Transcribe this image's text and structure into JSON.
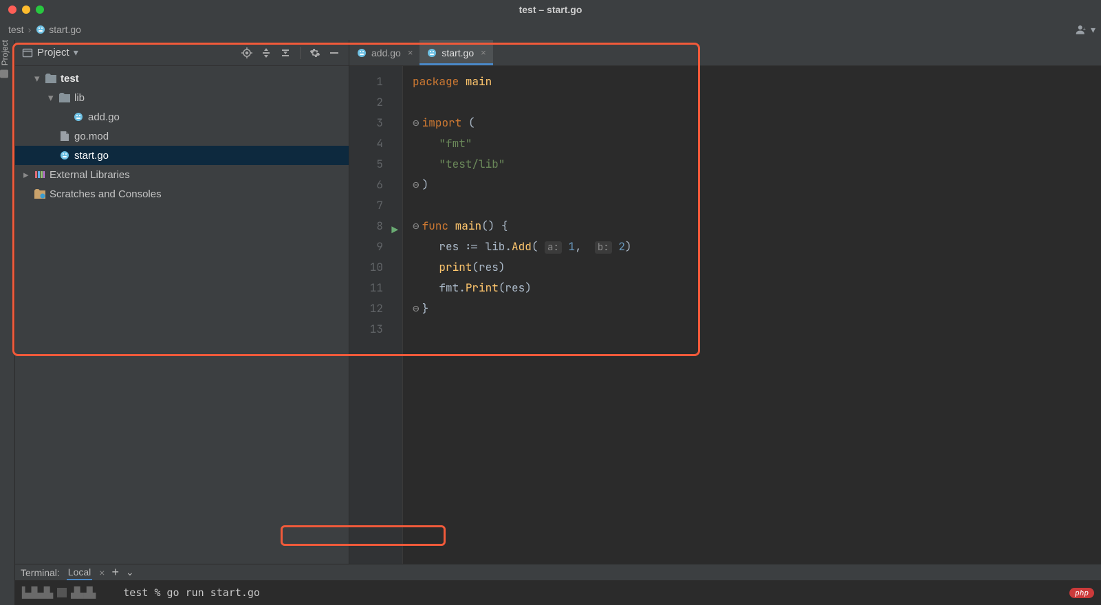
{
  "window": {
    "title": "test – start.go"
  },
  "breadcrumb": {
    "root": "test",
    "file": "start.go"
  },
  "leftStrip": {
    "label": "Project"
  },
  "projectPanel": {
    "title": "Project",
    "tree": {
      "root": "test",
      "lib": "lib",
      "add": "add.go",
      "gomod": "go.mod",
      "start": "start.go",
      "extlib": "External Libraries",
      "scratch": "Scratches and Consoles"
    }
  },
  "tabs": [
    {
      "name": "add.go",
      "active": false
    },
    {
      "name": "start.go",
      "active": true
    }
  ],
  "code": {
    "lines": [
      "1",
      "2",
      "3",
      "4",
      "5",
      "6",
      "7",
      "8",
      "9",
      "10",
      "11",
      "12",
      "13"
    ],
    "l1_package": "package",
    "l1_main": "main",
    "l3_import": "import",
    "l3_paren": "(",
    "l4_fmt": "\"fmt\"",
    "l5_testlib": "\"test/lib\"",
    "l6_paren": ")",
    "l8_func": "func",
    "l8_main": "main",
    "l8_tail": "() {",
    "l9_pre": "res := lib.",
    "l9_add": "Add",
    "l9_open": "(",
    "l9_hint_a": "a:",
    "l9_v1": "1",
    "l9_comma": ",",
    "l9_hint_b": "b:",
    "l9_v2": "2",
    "l9_close": ")",
    "l10_print": "print",
    "l10_arg": "(res)",
    "l11_fmt": "fmt.",
    "l11_print": "Print",
    "l11_arg": "(res)",
    "l12": "}"
  },
  "terminal": {
    "title": "Terminal:",
    "tab": "Local",
    "prompt_proj": "test",
    "prompt_sep": "%",
    "command": "go run start.go"
  },
  "badge": {
    "php": "php"
  }
}
